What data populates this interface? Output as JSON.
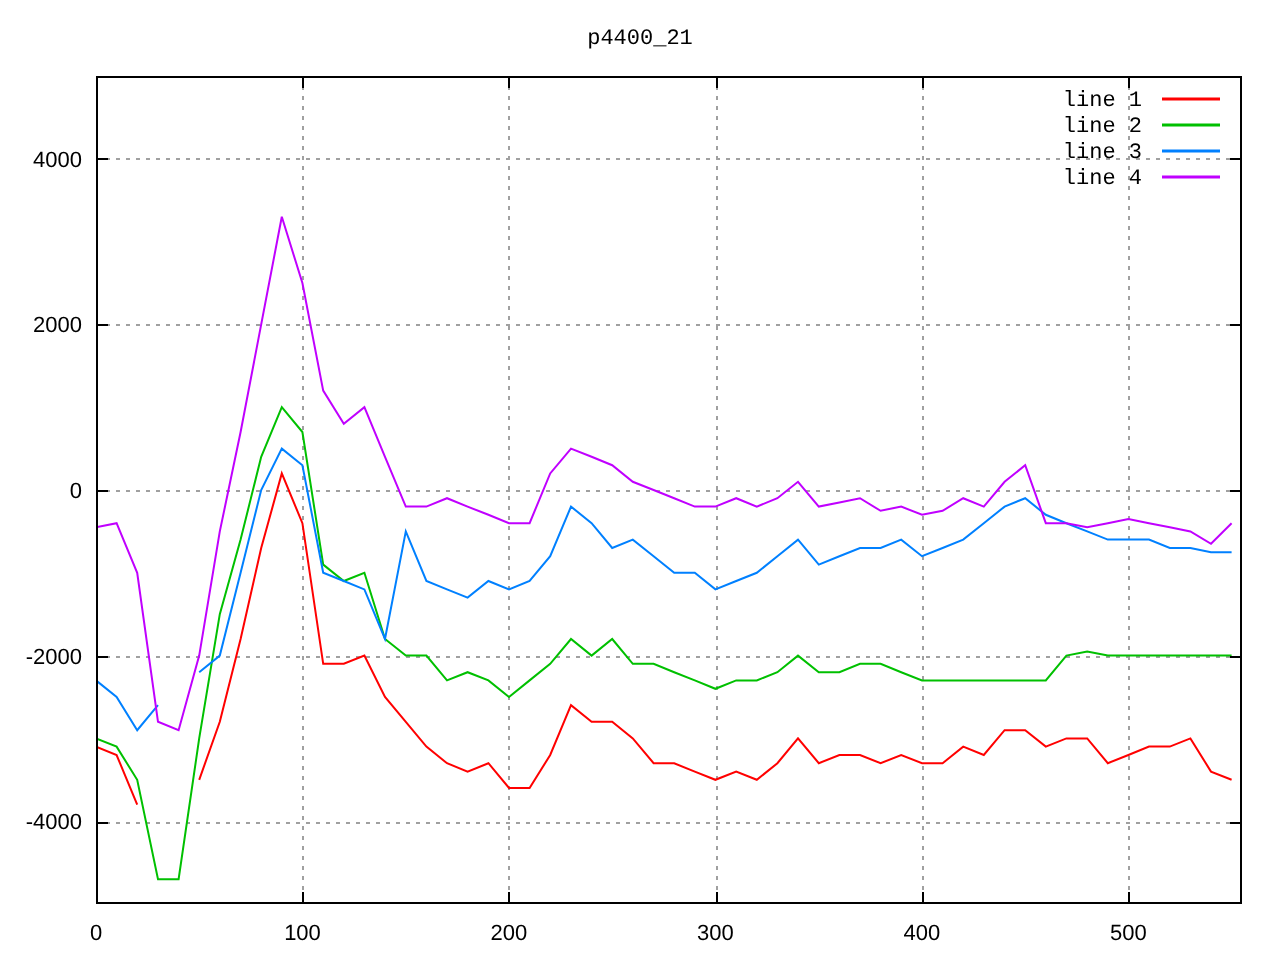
{
  "plot": {
    "chart_data": {
      "type": "line",
      "title": "p4400_21",
      "x": [
        0,
        10,
        20,
        30,
        40,
        50,
        60,
        70,
        80,
        90,
        100,
        110,
        120,
        130,
        140,
        150,
        160,
        170,
        180,
        190,
        200,
        210,
        220,
        230,
        240,
        250,
        260,
        270,
        280,
        290,
        300,
        310,
        320,
        330,
        340,
        350,
        360,
        370,
        380,
        390,
        400,
        410,
        420,
        430,
        440,
        450,
        460,
        470,
        480,
        490,
        500,
        510,
        520,
        530,
        540,
        550
      ],
      "xlim": [
        0,
        555
      ],
      "ylim": [
        -5000,
        5000
      ],
      "grid": true,
      "legend": true,
      "xticks": [
        0,
        100,
        200,
        300,
        400,
        500
      ],
      "yticks": [
        -4000,
        -2000,
        0,
        2000,
        4000
      ],
      "series": [
        {
          "name": "line 1",
          "color": "#ff0000",
          "values": [
            -3100,
            -3200,
            -3800,
            null,
            null,
            -3500,
            -2800,
            -1800,
            -700,
            200,
            -400,
            -2100,
            -2100,
            -2000,
            -2500,
            -2800,
            -3100,
            -3300,
            -3400,
            -3300,
            -3600,
            -3600,
            -3200,
            -2600,
            -2800,
            -2800,
            -3000,
            -3300,
            -3300,
            -3400,
            -3500,
            -3400,
            -3500,
            -3300,
            -3000,
            -3300,
            -3200,
            -3200,
            -3300,
            -3200,
            -3300,
            -3300,
            -3100,
            -3200,
            -2900,
            -2900,
            -3100,
            -3000,
            -3000,
            -3300,
            -3200,
            -3100,
            -3100,
            -3000,
            -3400,
            -3500
          ]
        },
        {
          "name": "line 2",
          "color": "#00c000",
          "values": [
            -3000,
            -3100,
            -3500,
            -4700,
            -4700,
            -3000,
            -1500,
            -600,
            400,
            1000,
            700,
            -900,
            -1100,
            -1000,
            -1800,
            -2000,
            -2000,
            -2300,
            -2200,
            -2300,
            -2500,
            -2300,
            -2100,
            -1800,
            -2000,
            -1800,
            -2100,
            -2100,
            -2200,
            -2300,
            -2400,
            -2300,
            -2300,
            -2200,
            -2000,
            -2200,
            -2200,
            -2100,
            -2100,
            -2200,
            -2300,
            -2300,
            -2300,
            -2300,
            -2300,
            -2300,
            -2300,
            -2000,
            -1950,
            -2000,
            -2000,
            -2000,
            -2000,
            -2000,
            -2000,
            -2000
          ]
        },
        {
          "name": "line 3",
          "color": "#0080ff",
          "values": [
            -2300,
            -2500,
            -2900,
            -2600,
            null,
            -2200,
            -2000,
            -1000,
            0,
            500,
            300,
            -1000,
            -1100,
            -1200,
            -1800,
            -500,
            -1100,
            -1200,
            -1300,
            -1100,
            -1200,
            -1100,
            -800,
            -200,
            -400,
            -700,
            -600,
            -800,
            -1000,
            -1000,
            -1200,
            -1100,
            -1000,
            -800,
            -600,
            -900,
            -800,
            -700,
            -700,
            -600,
            -800,
            -700,
            -600,
            -400,
            -200,
            -100,
            -300,
            -400,
            -500,
            -600,
            -600,
            -600,
            -700,
            -700,
            -750,
            -750
          ]
        },
        {
          "name": "line 4",
          "color": "#c000ff",
          "values": [
            -450,
            -400,
            -1000,
            -2800,
            -2900,
            -2000,
            -500,
            700,
            2000,
            3300,
            2500,
            1200,
            800,
            1000,
            400,
            -200,
            -200,
            -100,
            -200,
            -300,
            -400,
            -400,
            200,
            500,
            400,
            300,
            100,
            0,
            -100,
            -200,
            -200,
            -100,
            -200,
            -100,
            100,
            -200,
            -150,
            -100,
            -250,
            -200,
            -300,
            -250,
            -100,
            -200,
            100,
            300,
            -400,
            -400,
            -450,
            -400,
            -350,
            -400,
            -450,
            -500,
            -650,
            -400
          ]
        }
      ]
    }
  }
}
